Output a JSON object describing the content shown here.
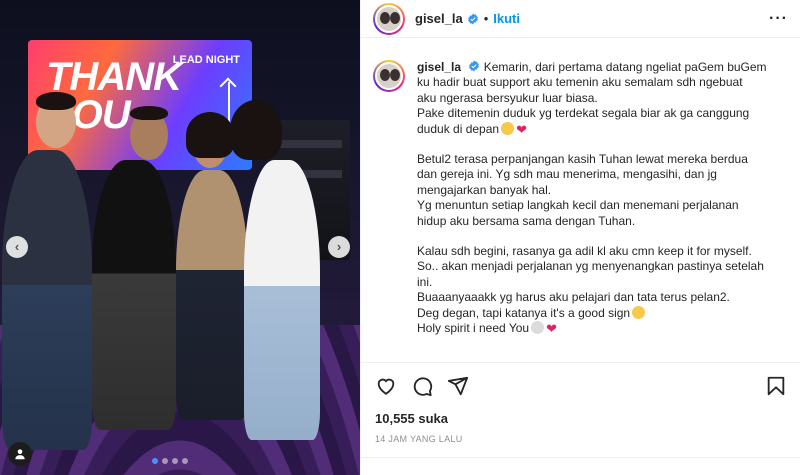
{
  "photo": {
    "screen_title": "THANK YOU",
    "screen_lead": "LEAD NIGHT",
    "prev_label": "‹",
    "next_label": "›",
    "carousel_count": 4,
    "carousel_active": 1
  },
  "header": {
    "username": "gisel_la",
    "separator": "•",
    "follow_label": "Ikuti",
    "more_label": "···"
  },
  "caption": {
    "username": "gisel_la",
    "lines": [
      "Kemarin, dari pertama datang ngeliat paGem buGem",
      "ku hadir buat support aku temenin aku semalam sdh ngebuat",
      "aku ngerasa bersyukur luar biasa.",
      "Pake ditemenin duduk yg terdekat segala biar ak ga canggung",
      "duduk di depan",
      "Betul2 terasa perpanjangan kasih Tuhan lewat mereka berdua",
      "dan gereja ini. Yg sdh mau menerima, mengasihi, dan jg",
      "mengajarkan banyak hal.",
      "Yg menuntun setiap langkah kecil dan menemani perjalanan",
      "hidup aku bersama sama dengan Tuhan.",
      "Kalau sdh begini, rasanya ga adil kl aku cmn keep it for myself.",
      "So.. akan menjadi perjalanan yg menyenangkan pastinya setelah",
      "ini.",
      "Buaaanyaaakk yg harus aku pelajari dan tata terus pelan2.",
      "Deg degan, tapi katanya it's a good sign",
      "Holy spirit i need You"
    ]
  },
  "footer": {
    "likes": "10,555 suka",
    "timestamp": "14 JAM YANG LALU"
  },
  "colors": {
    "accent": "#0095f6",
    "heart": "#e0245e",
    "text": "#262626",
    "muted": "#8e8e8e"
  }
}
